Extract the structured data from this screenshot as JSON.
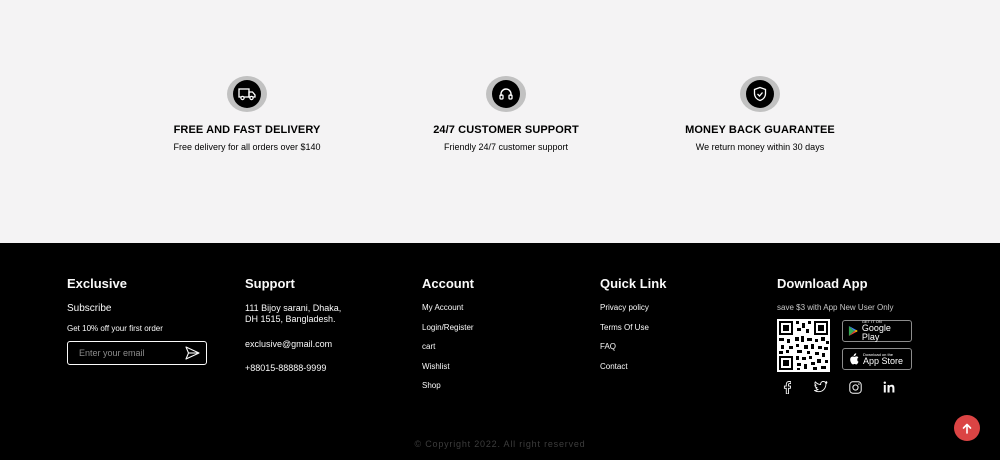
{
  "features": [
    {
      "icon": "delivery-truck-icon",
      "title": "FREE AND FAST DELIVERY",
      "description": "Free delivery for all orders over $140"
    },
    {
      "icon": "headphones-icon",
      "title": "24/7 CUSTOMER SUPPORT",
      "description": "Friendly 24/7 customer support"
    },
    {
      "icon": "shield-check-icon",
      "title": "MONEY BACK GUARANTEE",
      "description": "We return money within 30 days"
    }
  ],
  "footer": {
    "exclusive": {
      "title": "Exclusive",
      "subscribe": "Subscribe",
      "offer": "Get 10% off your first order",
      "email_placeholder": "Enter your email",
      "send_icon": "send-icon"
    },
    "support": {
      "title": "Support",
      "address": "111 Bijoy sarani, Dhaka,  DH 1515, Bangladesh.",
      "email": "exclusive@gmail.com",
      "phone": "+88015-88888-9999"
    },
    "account": {
      "title": "Account",
      "links": [
        "My Account",
        "Login/Register",
        "cart",
        "Wishlist",
        "Shop"
      ]
    },
    "quick_link": {
      "title": "Quick Link",
      "links": [
        "Privacy policy",
        "Terms Of Use",
        "FAQ",
        "Contact"
      ]
    },
    "download_app": {
      "title": "Download App",
      "note": "save $3 with App New User Only",
      "google_play": {
        "small": "GET IT ON",
        "big": "Google Play"
      },
      "app_store": {
        "small": "Download on the",
        "big": "App Store"
      },
      "socials": [
        "facebook-icon",
        "twitter-icon",
        "instagram-icon",
        "linkedin-icon"
      ]
    },
    "copyright": "© Copyright 2022.  All right reserved"
  },
  "colors": {
    "accent": "#db4444",
    "footer_bg": "#000000",
    "page_bg": "#f4f3f4"
  }
}
